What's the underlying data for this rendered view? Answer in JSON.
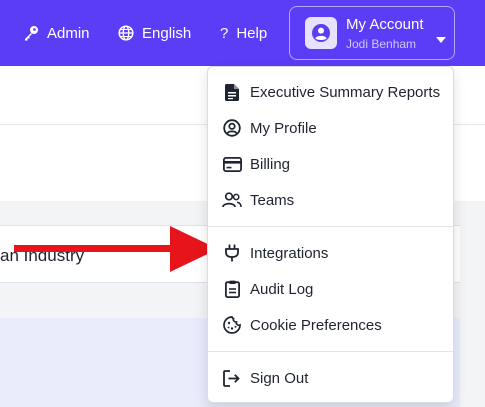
{
  "nav": {
    "admin_label": "Admin",
    "language_label": "English",
    "help_label": "Help",
    "help_glyph": "?"
  },
  "account": {
    "title": "My Account",
    "username": "Jodi Benham"
  },
  "menu": {
    "items": [
      {
        "label": "Executive Summary Reports",
        "icon": "document-icon"
      },
      {
        "label": "My Profile",
        "icon": "user-circle-icon"
      },
      {
        "label": "Billing",
        "icon": "credit-card-icon"
      },
      {
        "label": "Teams",
        "icon": "users-icon"
      },
      {
        "label": "Integrations",
        "icon": "plug-icon"
      },
      {
        "label": "Audit Log",
        "icon": "clipboard-icon"
      },
      {
        "label": "Cookie Preferences",
        "icon": "cookie-icon"
      },
      {
        "label": "Sign Out",
        "icon": "sign-out-icon"
      }
    ]
  },
  "background": {
    "industry_text": "an Industry"
  },
  "colors": {
    "brand": "#5b3df5",
    "arrow": "#e8141b"
  }
}
